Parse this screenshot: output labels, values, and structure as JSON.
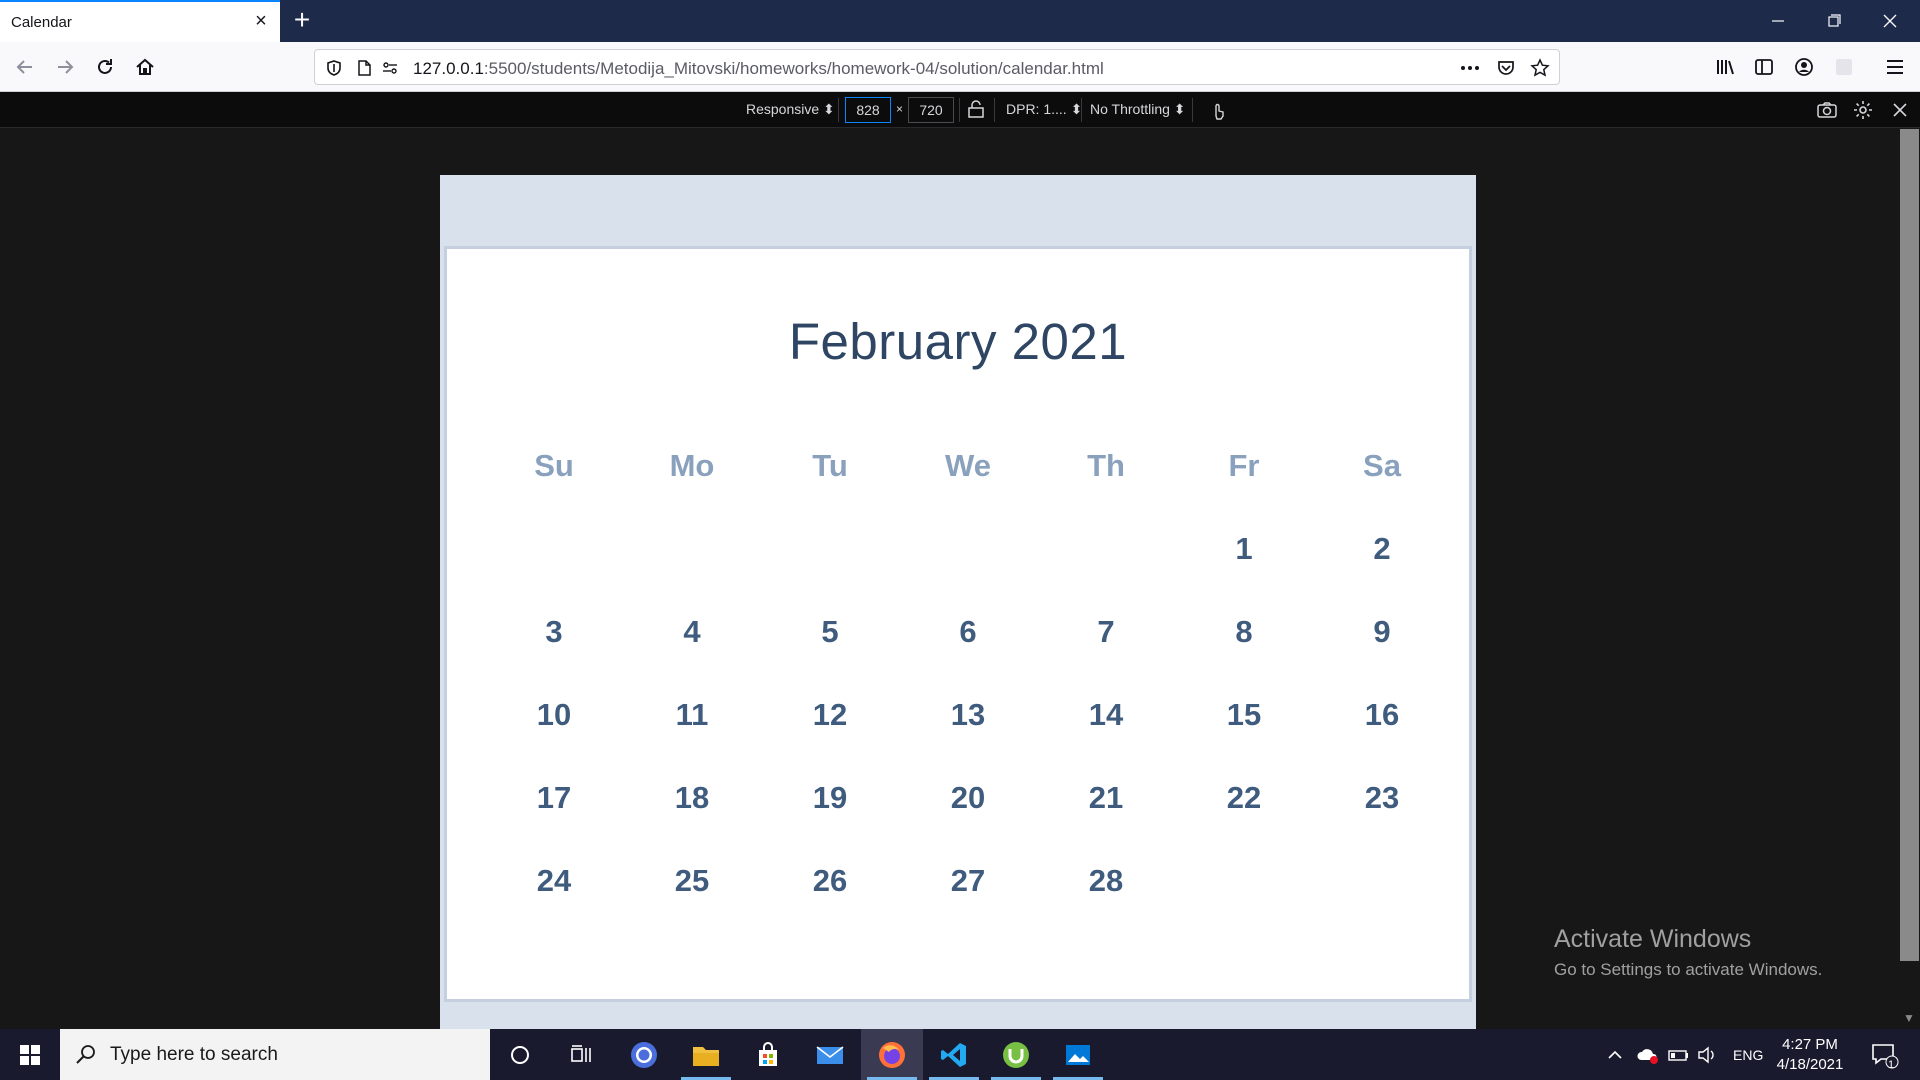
{
  "browser": {
    "tab_title": "Calendar",
    "url_host": "127.0.0.1",
    "url_rest": ":5500/students/Metodija_Mitovski/homeworks/homework-04/solution/calendar.html"
  },
  "rdm": {
    "device": "Responsive ⬍",
    "width": "828",
    "height": "720",
    "times": "×",
    "dpr": "DPR: 1.... ⬍",
    "throttling": "No Throttling ⬍"
  },
  "calendar": {
    "title": "February 2021",
    "weekdays": [
      "Su",
      "Mo",
      "Tu",
      "We",
      "Th",
      "Fr",
      "Sa"
    ],
    "days": [
      "",
      "",
      "",
      "",
      "",
      "1",
      "2",
      "3",
      "4",
      "5",
      "6",
      "7",
      "8",
      "9",
      "10",
      "11",
      "12",
      "13",
      "14",
      "15",
      "16",
      "17",
      "18",
      "19",
      "20",
      "21",
      "22",
      "23",
      "24",
      "25",
      "26",
      "27",
      "28",
      "",
      ""
    ]
  },
  "watermark": {
    "title": "Activate Windows",
    "subtitle": "Go to Settings to activate Windows."
  },
  "taskbar": {
    "search_placeholder": "Type here to search",
    "lang": "ENG",
    "time": "4:27 PM",
    "date": "4/18/2021",
    "notification_count": "1",
    "apps": [
      "cortana-icon",
      "task-view-icon",
      "chrome-icon",
      "file-explorer-icon",
      "store-icon",
      "mail-icon",
      "firefox-icon",
      "vscode-icon",
      "utorrent-icon",
      "photos-icon"
    ]
  },
  "colors": {
    "accent": "#0a84ff",
    "calendar_title": "#2e4563",
    "calendar_days": "#3f5b7d",
    "calendar_weekdays": "#8aa1bd",
    "device_bg": "#d9e1ec"
  }
}
